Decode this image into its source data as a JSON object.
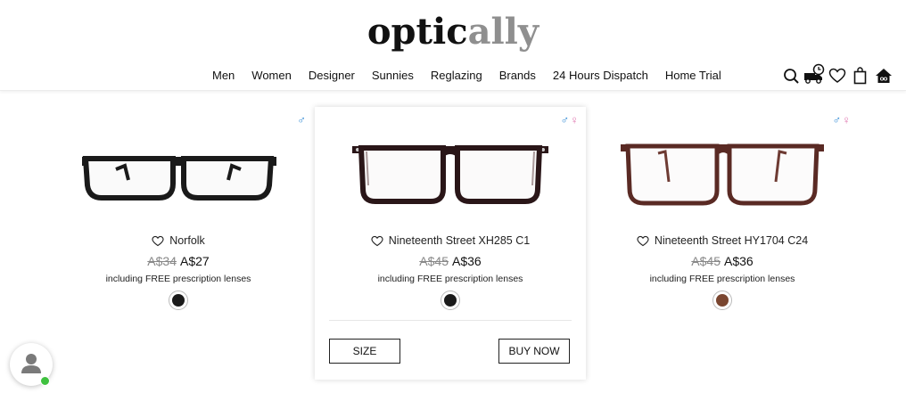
{
  "logo": {
    "part1": "optic",
    "part2": "ally"
  },
  "nav": [
    "Men",
    "Women",
    "Designer",
    "Sunnies",
    "Reglazing",
    "Brands",
    "24 Hours Dispatch",
    "Home Trial"
  ],
  "header_icons": [
    "search-icon",
    "delivery-truck-icon",
    "heart-icon",
    "shopping-bag-icon",
    "home-trial-icon"
  ],
  "products": [
    {
      "name": "Norfolk",
      "old_price": "A$34",
      "new_price": "A$27",
      "note": "including FREE prescription lenses",
      "gender": "♂",
      "gender_f": "",
      "frame_color": "#1a1a1a",
      "swatch_color": "#1b1b1b"
    },
    {
      "name": "Nineteenth Street XH285 C1",
      "old_price": "A$45",
      "new_price": "A$36",
      "note": "including FREE prescription lenses",
      "gender": "♂",
      "gender_f": "♀",
      "frame_color": "#2a1618",
      "swatch_color": "#1b1b1b",
      "size_label": "SIZE",
      "buy_label": "BUY NOW"
    },
    {
      "name": "Nineteenth Street HY1704 C24",
      "old_price": "A$45",
      "new_price": "A$36",
      "note": "including FREE prescription lenses",
      "gender": "♂",
      "gender_f": "♀",
      "frame_color": "#5a2a24",
      "swatch_color": "#7a4630"
    }
  ],
  "colors": {
    "male": "#3a8fd6",
    "female": "#e07ab2",
    "online": "#3fc13f"
  }
}
